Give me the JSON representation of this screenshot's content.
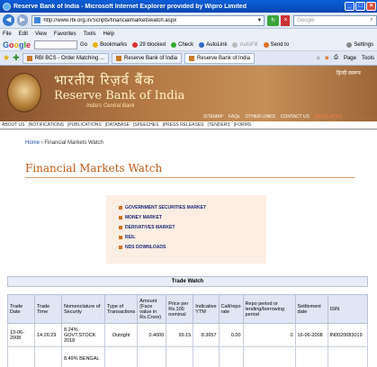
{
  "window": {
    "title": "Reserve Bank of India - Microsoft Internet Explorer provided by Wipro Limited"
  },
  "address_bar": {
    "url": "http://www.rbi.org.in/Scripts/financialmarketswatch.aspx",
    "search_placeholder": "Google"
  },
  "menu": [
    "File",
    "Edit",
    "View",
    "Favorites",
    "Tools",
    "Help"
  ],
  "google_toolbar": {
    "logo": "Google",
    "go_label": "Go",
    "items": [
      "Bookmarks",
      "29 blocked",
      "Check",
      "AutoLink",
      "AutoFill",
      "Send to"
    ],
    "settings": "Settings"
  },
  "tabs": [
    {
      "label": "RBI BCS - Order Matching ...",
      "active": false
    },
    {
      "label": "Reserve Bank of India",
      "active": false
    },
    {
      "label": "Reserve Bank of India",
      "active": true
    }
  ],
  "tab_tools": {
    "page": "Page",
    "tools": "Tools"
  },
  "banner": {
    "hindi_name": "भारतीय रिज़र्व बैंक",
    "name": "Reserve Bank of India",
    "subtitle": "India's Central Bank",
    "hindi_link": "हिन्दी स्वरूप",
    "links": [
      "SITEMAP",
      "FAQs",
      "OTHER LINKS",
      "CONTACT US",
      "REGULATED"
    ]
  },
  "main_nav": [
    "ABOUT US",
    "NOTIFICATIONS",
    "PUBLICATIONS",
    "DATABASE",
    "SPEECHES",
    "PRESS RELEASES",
    "TENDERS",
    "FORMS"
  ],
  "breadcrumb": {
    "home": "Home",
    "current": "Financial Markets Watch"
  },
  "page_title": "Financial Markets Watch",
  "market_links": [
    "GOVERNMENT SECURITIES MARKET",
    "MONEY MARKET",
    "DERIVATIVES MARKET",
    "REIL",
    "NDS DOWNLOADS"
  ],
  "colors": {
    "title": "#c45a18",
    "link": "#1a2a7a",
    "box_bg": "#fdeee3"
  },
  "trade_watch": {
    "heading": "Trade Watch",
    "columns": [
      "Trade Date",
      "Trade Time",
      "Nomenclature of Security",
      "Type of Transactions",
      "Amount (Face value in Rs.Crore)",
      "Price per Rs.100 nominal",
      "Indicative YTM",
      "Call/repo rate",
      "Repo period or lending/borrowing period",
      "Settlement date",
      "ISIN"
    ],
    "rows": [
      [
        "13-06-2008",
        "14:26:29",
        "8.24% GOVT.STOCK 2018",
        "Outright",
        "0.4000",
        "99.15",
        "8.3657",
        "0.00",
        "0",
        "16-06-2008",
        "IN0020083019"
      ],
      [
        "",
        "",
        "8.49% BENGAL",
        "",
        "",
        "",
        "",
        "",
        "",
        "",
        ""
      ]
    ]
  }
}
